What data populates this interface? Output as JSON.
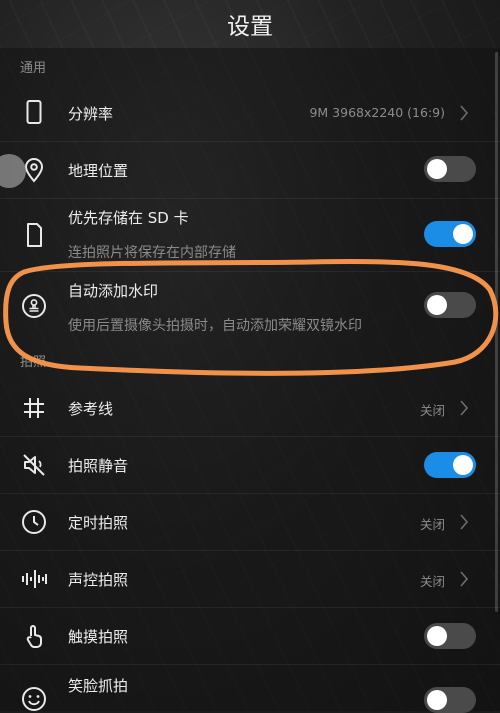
{
  "header": {
    "title": "设置"
  },
  "sections": {
    "general": "通用",
    "photo": "拍照"
  },
  "general_items": [
    {
      "name": "resolution",
      "label": "分辨率",
      "value": "9M 3968x2240 (16:9)",
      "icon": "phone-outline-icon"
    },
    {
      "name": "location",
      "label": "地理位置",
      "toggle": "off",
      "icon": "location-pin-icon"
    },
    {
      "name": "sd-storage",
      "label": "优先存储在 SD 卡",
      "subtitle": "连拍照片将保存在内部存储",
      "toggle": "on",
      "icon": "document-icon"
    },
    {
      "name": "watermark",
      "label": "自动添加水印",
      "subtitle": "使用后置摄像头拍摄时，自动添加荣耀双镜水印",
      "toggle": "off",
      "icon": "stamp-icon"
    }
  ],
  "photo_items": [
    {
      "name": "grid",
      "label": "参考线",
      "value": "关闭",
      "icon": "grid-hash-icon"
    },
    {
      "name": "mute",
      "label": "拍照静音",
      "toggle": "on",
      "icon": "muted-speaker-icon"
    },
    {
      "name": "timer",
      "label": "定时拍照",
      "value": "关闭",
      "icon": "clock-icon"
    },
    {
      "name": "voice",
      "label": "声控拍照",
      "value": "关闭",
      "icon": "sound-wave-icon"
    },
    {
      "name": "touch",
      "label": "触摸拍照",
      "toggle": "off",
      "icon": "touch-finger-icon"
    },
    {
      "name": "smile",
      "label": "笑脸抓拍",
      "toggle": "off",
      "icon": "smiley-icon"
    }
  ],
  "colors": {
    "accent": "#1c8de6",
    "annotation": "#f0924a"
  }
}
